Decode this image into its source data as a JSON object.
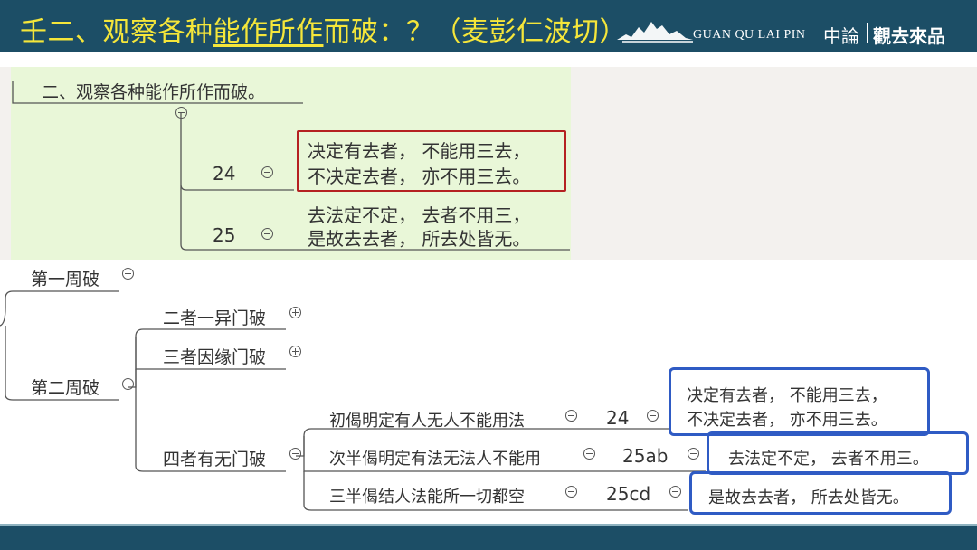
{
  "header": {
    "title_pre": "壬二、观察各种",
    "title_ul": "能作所作",
    "title_post": "而破：？（麦彭仁波切）",
    "brand_en": "GUAN QU LAI PIN",
    "brand_cn1": "中論",
    "brand_cn2": "觀去來品"
  },
  "top_tree": {
    "root": "二、观察各种能作所作而破。",
    "verse_24_num": "24",
    "verse_24_line1": "决定有去者， 不能用三去，",
    "verse_24_line2": "不决定去者， 亦不用三去。",
    "verse_25_num": "25",
    "verse_25_line1": "去法定不定， 去者不用三，",
    "verse_25_line2": "是故去去者， 所去处皆无。"
  },
  "bottom_tree": {
    "first": "第一周破",
    "second": "第二周破",
    "n1": "二者一异门破",
    "n2": "三者因缘门破",
    "n3": "四者有无门破",
    "c1": "初偈明定有人无人不能用法",
    "c1_num": "24",
    "c1_line1": "决定有去者， 不能用三去，",
    "c1_line2": "不决定去者， 亦不用三去。",
    "c2": "次半偈明定有法无法人不能用",
    "c2_num": "25ab",
    "c2_text": "去法定不定， 去者不用三。",
    "c3": "三半偈结人法能所一切都空",
    "c3_num": "25cd",
    "c3_text": "是故去去者， 所去处皆无。"
  },
  "colors": {
    "header_bg": "#1c4e66",
    "title_color": "#f5e63a",
    "top_panel_bg": "#e9f7d8",
    "red_box": "#b52121",
    "blue_box": "#2f5bc4"
  }
}
